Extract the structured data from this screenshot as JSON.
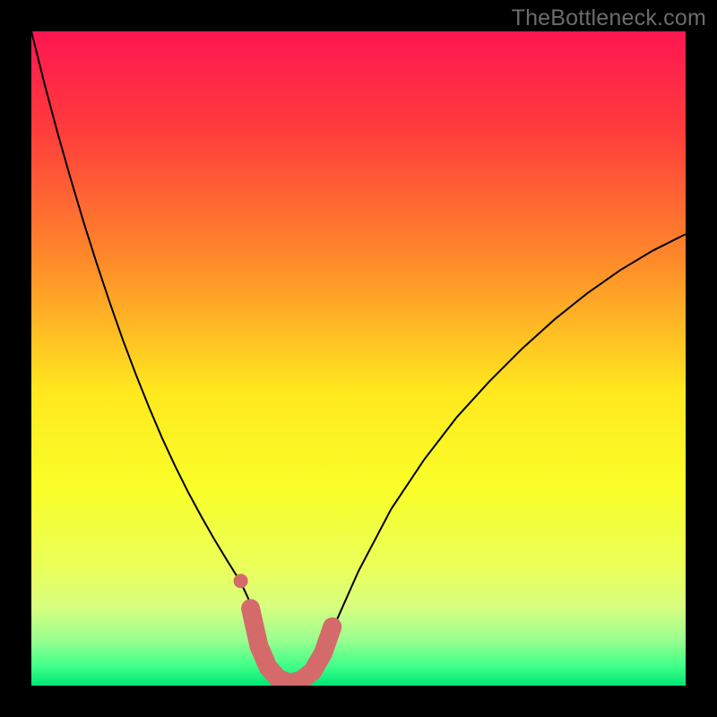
{
  "watermark": "TheBottleneck.com",
  "chart_data": {
    "type": "line",
    "title": "",
    "xlabel": "",
    "ylabel": "",
    "xlim": [
      0,
      1
    ],
    "ylim": [
      0.0,
      1.0
    ],
    "background_gradient": {
      "type": "vertical",
      "stops": [
        {
          "offset": 0.0,
          "color": "#ff1651"
        },
        {
          "offset": 0.15,
          "color": "#ff3c3c"
        },
        {
          "offset": 0.35,
          "color": "#ff8a2a"
        },
        {
          "offset": 0.55,
          "color": "#ffe81e"
        },
        {
          "offset": 0.7,
          "color": "#f9ff2a"
        },
        {
          "offset": 0.82,
          "color": "#eaff5a"
        },
        {
          "offset": 0.88,
          "color": "#d8ff80"
        },
        {
          "offset": 0.93,
          "color": "#9aff90"
        },
        {
          "offset": 0.97,
          "color": "#40ff88"
        },
        {
          "offset": 1.0,
          "color": "#00e676"
        }
      ]
    },
    "series": [
      {
        "name": "bottleneck-curve",
        "color": "#000000",
        "stroke_width": 2,
        "x": [
          0.0,
          0.02,
          0.04,
          0.06,
          0.08,
          0.1,
          0.12,
          0.14,
          0.16,
          0.18,
          0.2,
          0.22,
          0.24,
          0.26,
          0.28,
          0.3,
          0.32,
          0.34,
          0.35,
          0.36,
          0.38,
          0.4,
          0.42,
          0.44,
          0.46,
          0.5,
          0.55,
          0.6,
          0.65,
          0.7,
          0.75,
          0.8,
          0.85,
          0.9,
          0.95,
          1.0
        ],
        "y": [
          1.0,
          0.92,
          0.845,
          0.775,
          0.708,
          0.645,
          0.585,
          0.528,
          0.475,
          0.425,
          0.378,
          0.335,
          0.295,
          0.258,
          0.223,
          0.19,
          0.158,
          0.115,
          0.075,
          0.04,
          0.012,
          0.003,
          0.012,
          0.04,
          0.085,
          0.175,
          0.27,
          0.345,
          0.41,
          0.465,
          0.515,
          0.56,
          0.6,
          0.635,
          0.665,
          0.69
        ]
      },
      {
        "name": "highlight-markers",
        "color": "#d56a6a",
        "marker_radius": 10,
        "x": [
          0.335,
          0.348,
          0.362,
          0.378,
          0.395,
          0.412,
          0.43,
          0.446,
          0.46
        ],
        "y": [
          0.118,
          0.06,
          0.028,
          0.01,
          0.004,
          0.008,
          0.022,
          0.05,
          0.09
        ]
      },
      {
        "name": "outlier-marker",
        "color": "#d56a6a",
        "marker_radius": 8,
        "x": [
          0.32
        ],
        "y": [
          0.16
        ]
      }
    ]
  }
}
